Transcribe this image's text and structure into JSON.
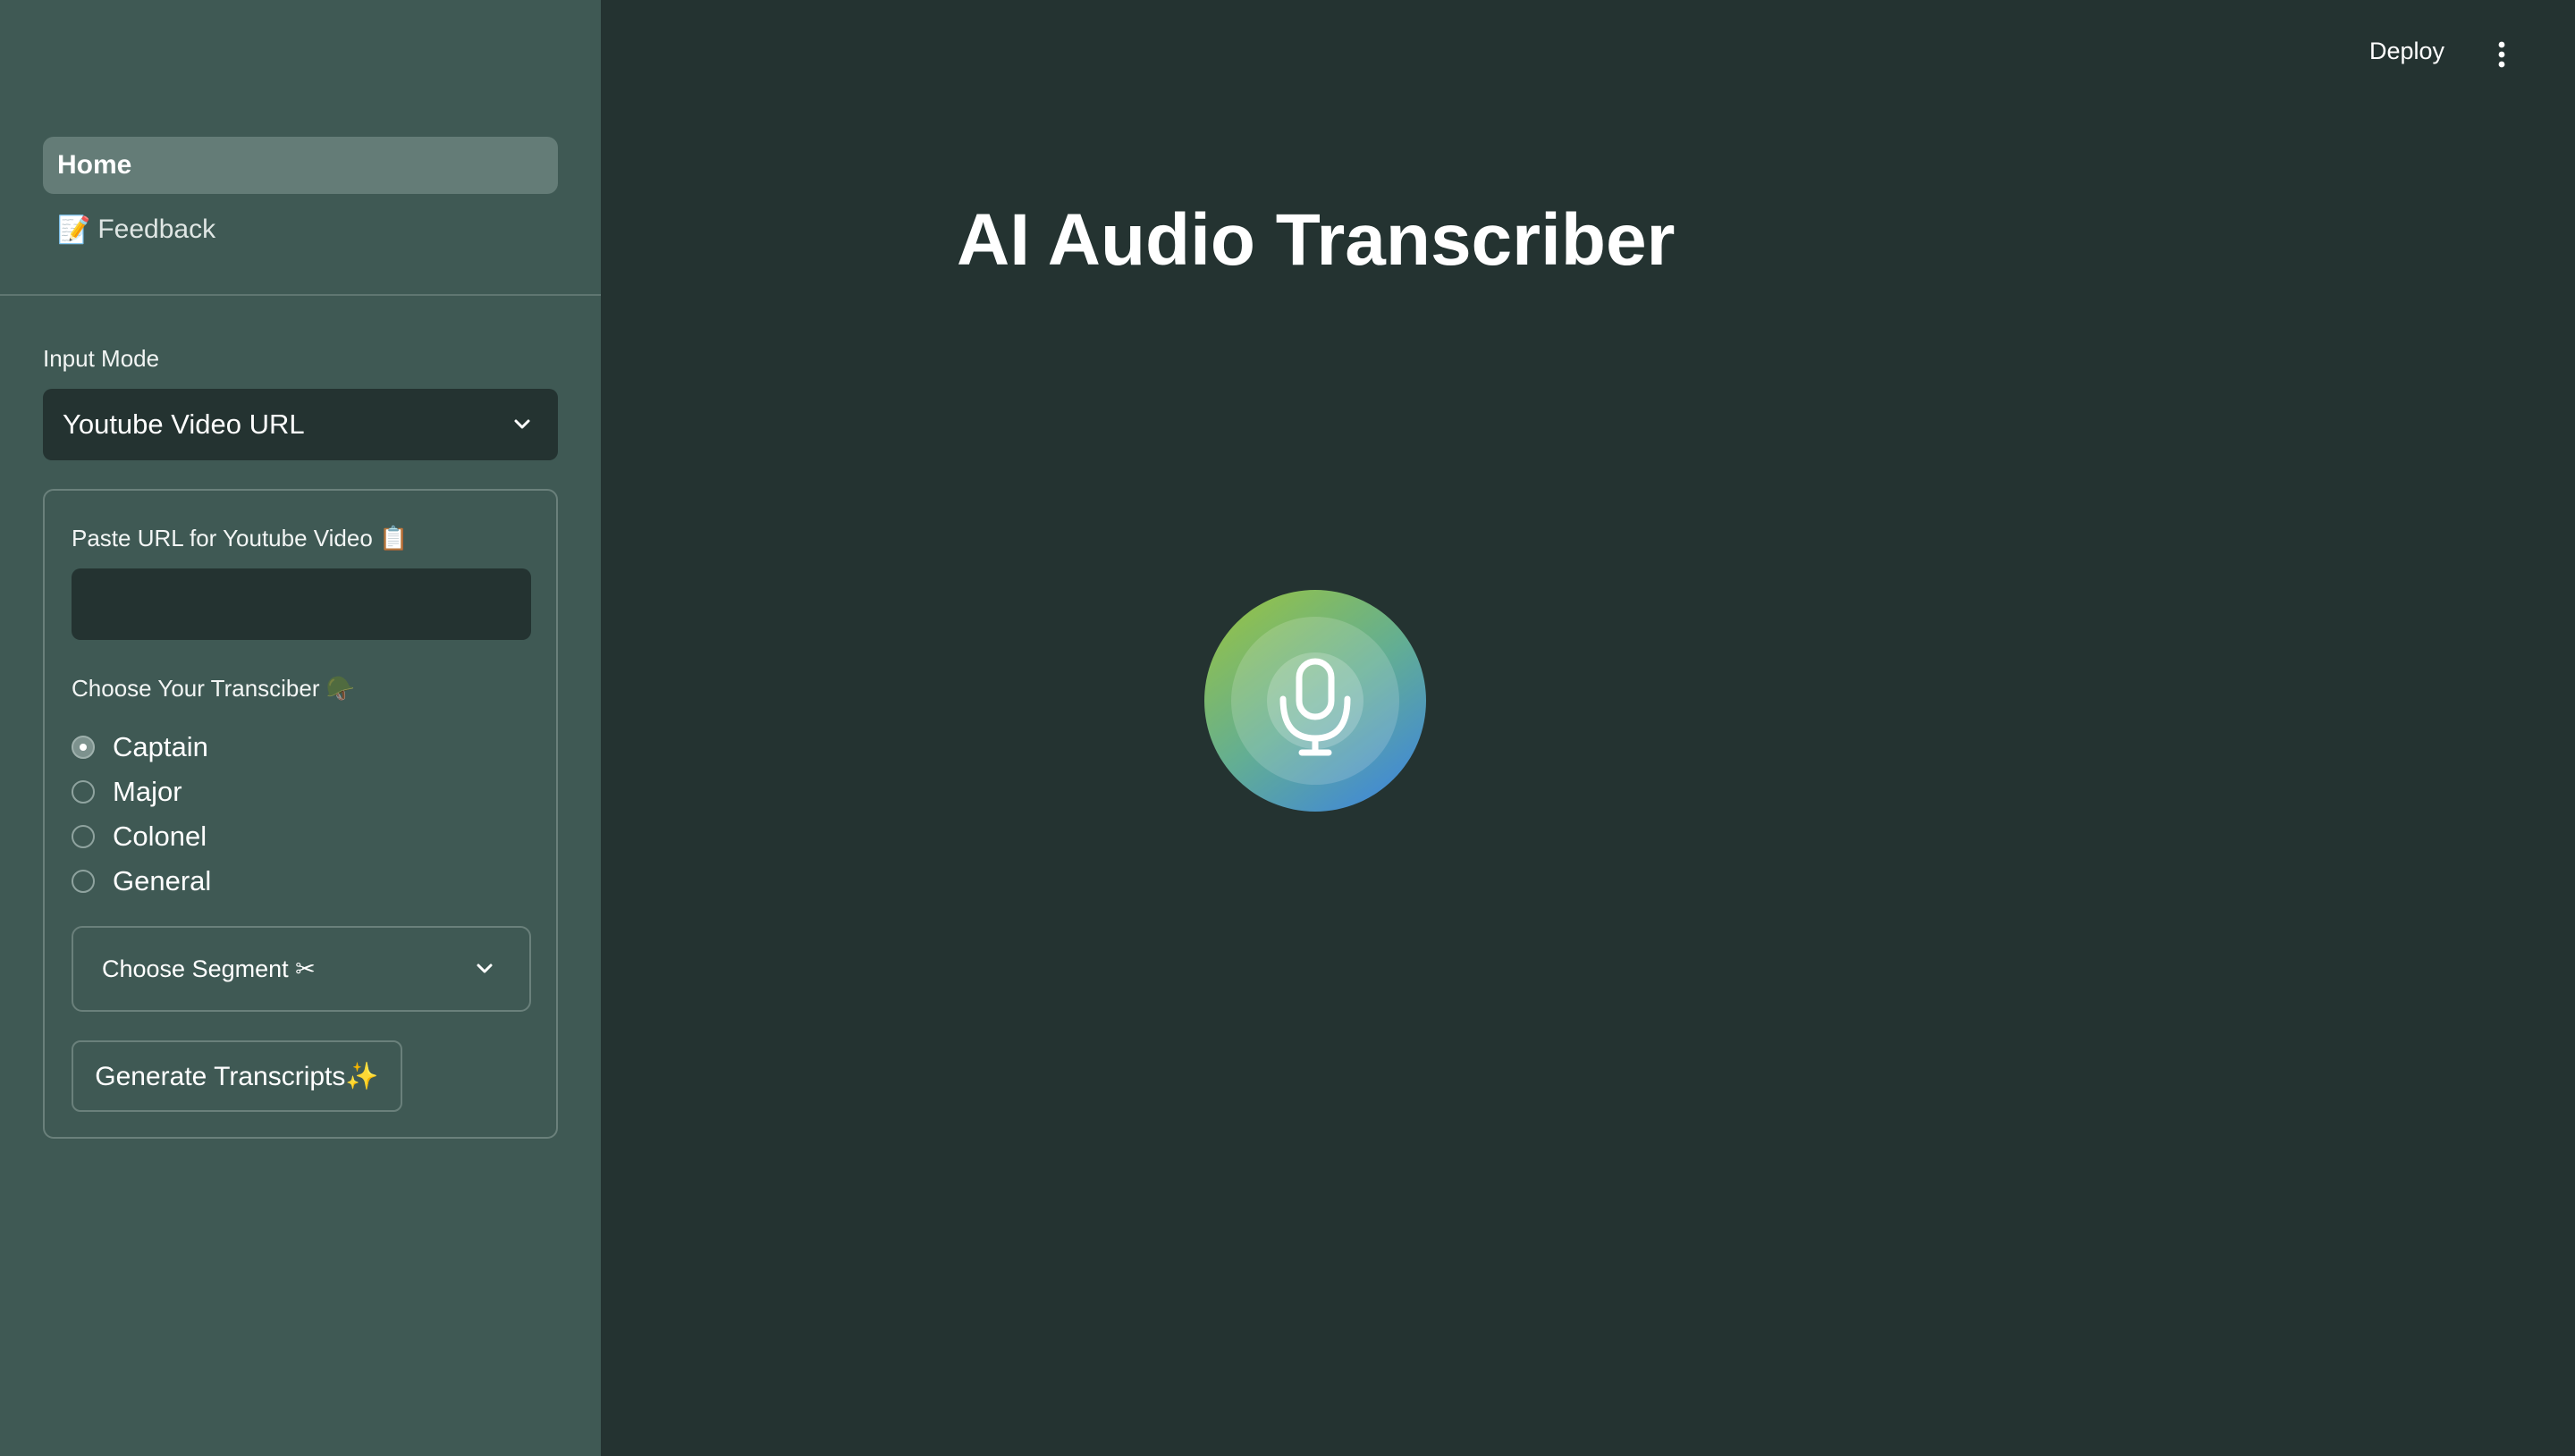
{
  "sidebar": {
    "nav": [
      {
        "label": "Home",
        "icon": ""
      },
      {
        "label": "Feedback",
        "icon": "📝"
      }
    ],
    "input_mode": {
      "label": "Input Mode",
      "selected": "Youtube Video URL"
    },
    "url_field": {
      "label": "Paste URL for Youtube Video 📋",
      "value": "",
      "placeholder": ""
    },
    "transcriber": {
      "label": "Choose Your Transciber 🪖",
      "options": [
        "Captain",
        "Major",
        "Colonel",
        "General"
      ],
      "selected": "Captain"
    },
    "segment": {
      "label": "Choose Segment ✂"
    },
    "generate_button": "Generate Transcripts✨"
  },
  "header": {
    "deploy": "Deploy",
    "menu_icon": "vertical-ellipsis-icon"
  },
  "main": {
    "title": "AI Audio Transcriber",
    "hero_icon": "microphone-soundwave-icon"
  },
  "colors": {
    "sidebar_bg": "#3f5954",
    "main_bg": "#243331",
    "nav_active": "#647c77",
    "wave_green": "#8fbe5a",
    "wave_blue": "#4a90d9"
  }
}
